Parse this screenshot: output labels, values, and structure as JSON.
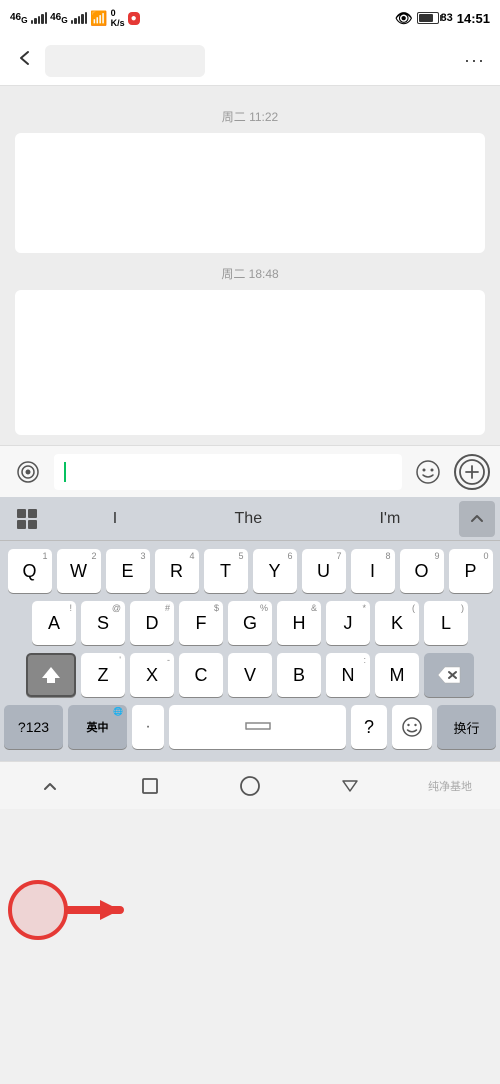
{
  "statusBar": {
    "carrier1": "46",
    "carrier2": "46",
    "signal1": "G",
    "wifiSignal": "0 K/s",
    "time": "14:51",
    "batteryPercent": "83"
  },
  "navBar": {
    "backIcon": "‹",
    "moreIcon": "···"
  },
  "chat": {
    "timestamp1": "周二 11:22",
    "timestamp2": "周二 18:48"
  },
  "inputBar": {
    "voiceIcon": "🔊",
    "emojiIcon": "😊",
    "plusIcon": "+"
  },
  "predictive": {
    "word1": "I",
    "word2": "The",
    "word3": "I'm"
  },
  "keyboard": {
    "row1": [
      "Q",
      "W",
      "E",
      "R",
      "T",
      "Y",
      "U",
      "I",
      "O",
      "P"
    ],
    "row1nums": [
      "1",
      "2",
      "3",
      "4",
      "5",
      "6",
      "7",
      "8",
      "9",
      "0"
    ],
    "row2": [
      "A",
      "S",
      "D",
      "F",
      "G",
      "H",
      "J",
      "K",
      "L"
    ],
    "row3": [
      "Z",
      "X",
      "C",
      "V",
      "B",
      "N",
      "M"
    ],
    "numKey": "?123",
    "langKey": "英中",
    "spaceKey": "·",
    "questionKey": "?",
    "emojiKey": "😊",
    "enterKey": "换行"
  },
  "bottomNav": {
    "backIcon": "∨",
    "homeIcon": "□",
    "circleIcon": "○",
    "triangleIcon": "∇",
    "watermarkText": "纯净基地"
  }
}
